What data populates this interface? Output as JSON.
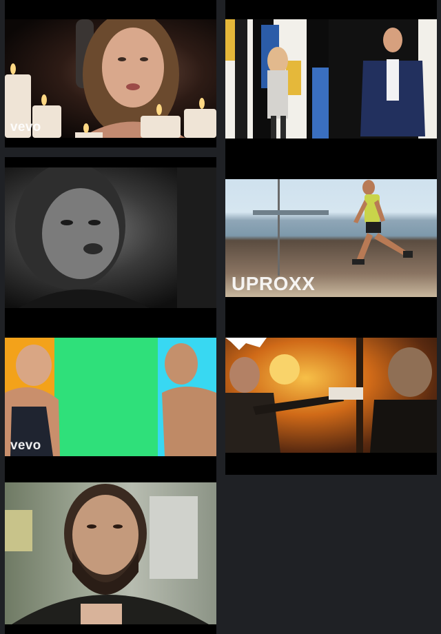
{
  "videos": [
    {
      "watermark": "vevo"
    },
    {
      "watermark": ""
    },
    {
      "watermark": ""
    },
    {
      "watermark": "UPROXX"
    },
    {
      "watermark": "vevo"
    },
    {
      "watermark": ""
    },
    {
      "watermark": ""
    }
  ],
  "colors": {
    "page_background": "#1f2125",
    "tile_background": "#000000"
  }
}
